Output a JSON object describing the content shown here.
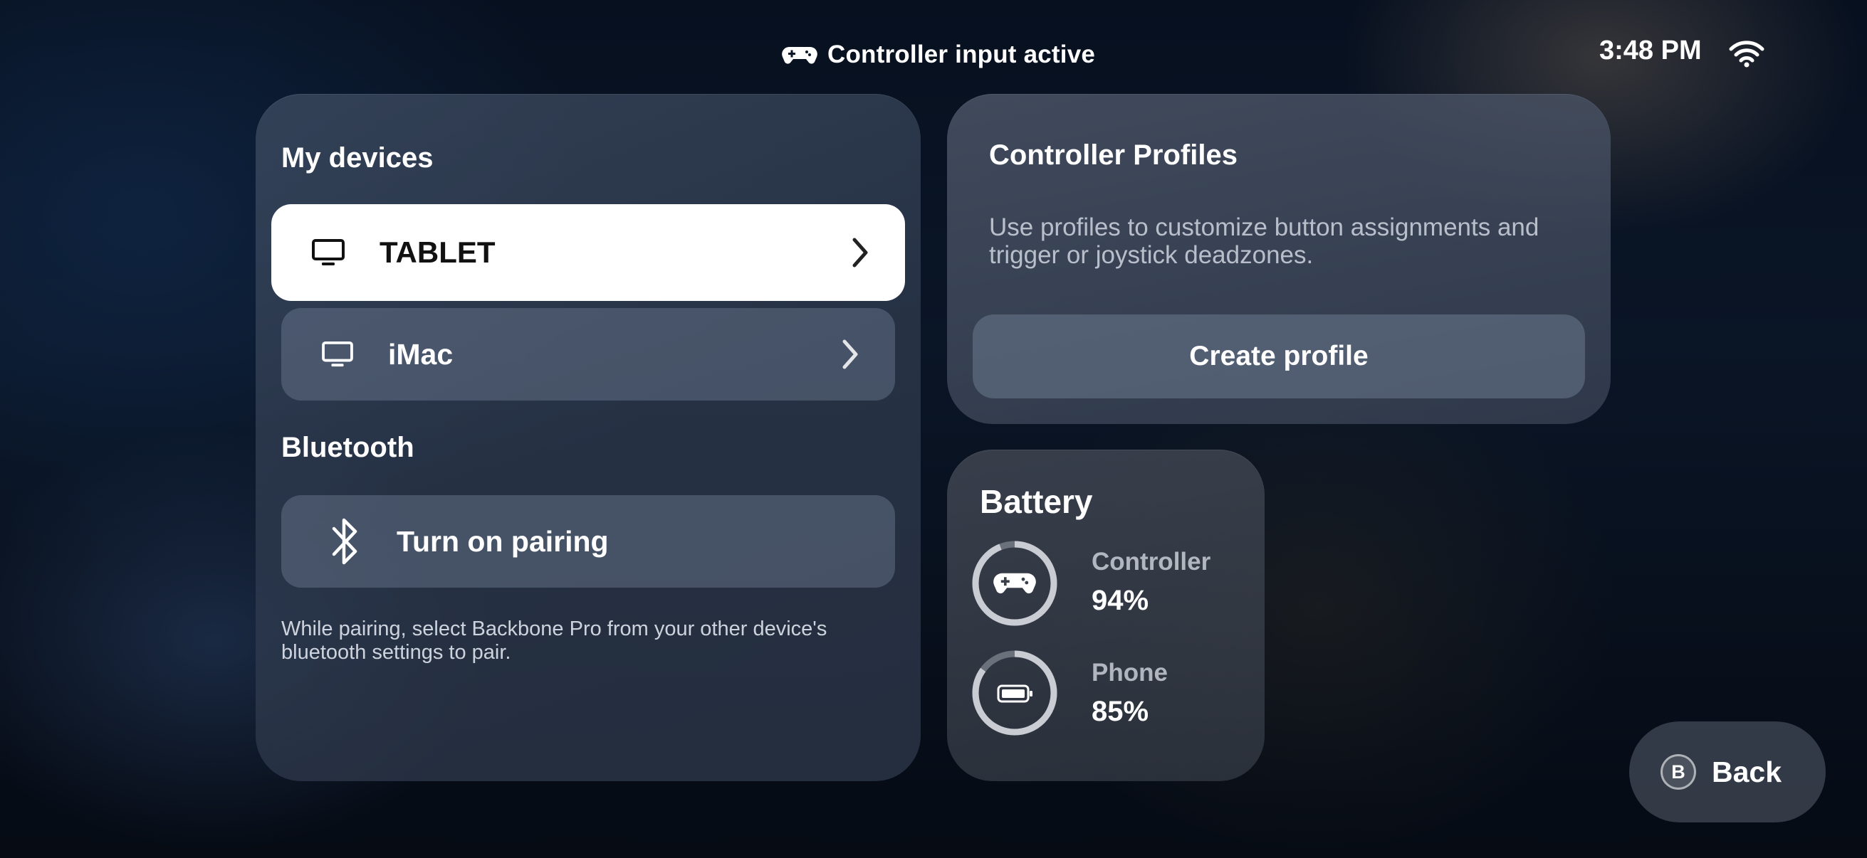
{
  "status_bar": {
    "input_status": "Controller input active",
    "time": "3:48 PM"
  },
  "devices": {
    "title": "My devices",
    "items": [
      {
        "label": "TABLET",
        "icon": "monitor-icon",
        "selected": true
      },
      {
        "label": "iMac",
        "icon": "monitor-icon",
        "selected": false
      }
    ]
  },
  "bluetooth": {
    "title": "Bluetooth",
    "pairing_label": "Turn on pairing",
    "hint": "While pairing, select Backbone Pro from your other device's bluetooth settings to pair."
  },
  "profiles": {
    "title": "Controller Profiles",
    "description": "Use profiles to customize button assignments and trigger or joystick deadzones.",
    "create_label": "Create profile"
  },
  "battery": {
    "title": "Battery",
    "items": [
      {
        "label": "Controller",
        "value": "94%",
        "level": 0.94,
        "icon": "gamepad-icon"
      },
      {
        "label": "Phone",
        "value": "85%",
        "level": 0.85,
        "icon": "battery-icon"
      }
    ]
  },
  "back": {
    "key": "B",
    "label": "Back"
  },
  "colors": {
    "ring_track": "#6b717b",
    "ring_fill": "#c9ccd2",
    "selected_row": "#ffffff"
  }
}
